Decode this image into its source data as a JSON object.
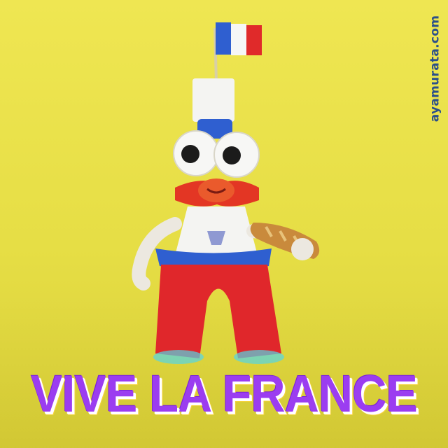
{
  "watermark": "ayamurata.com",
  "caption": "VIVE LA FRANCE",
  "colors": {
    "background": "#e9e24a",
    "caption": "#9b3df0",
    "flag_blue": "#2f5fd0",
    "flag_white": "#f6f6f6",
    "flag_red": "#e02a2a"
  }
}
